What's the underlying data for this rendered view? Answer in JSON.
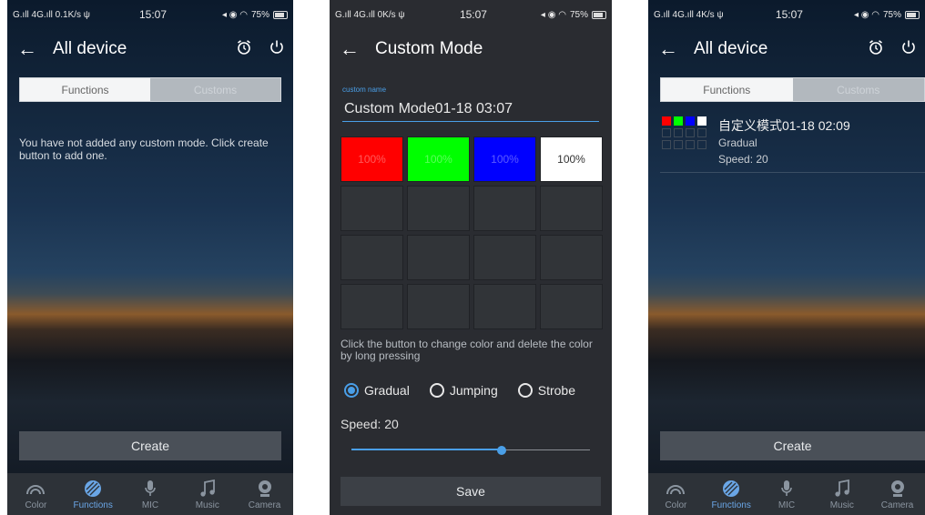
{
  "statusbar": [
    {
      "left": "G.ıll 4G.ıll 0.1K/s ψ",
      "time": "15:07",
      "right": "75%"
    },
    {
      "left": "G.ıll 4G.ıll 0K/s ψ",
      "time": "15:07",
      "right": "75%"
    },
    {
      "left": "G.ıll 4G.ıll 4K/s ψ",
      "time": "15:07",
      "right": "75%"
    }
  ],
  "screen1": {
    "title": "All device",
    "tabs": [
      "Functions",
      "Customs"
    ],
    "empty_message": "You have not added any custom mode. Click create button to add one.",
    "create_label": "Create"
  },
  "screen2": {
    "title": "Custom Mode",
    "field_label": "custom name",
    "name_value": "Custom Mode01-18 03:07",
    "colors": [
      {
        "hex": "#ff0000",
        "label": "100%"
      },
      {
        "hex": "#00ff00",
        "label": "100%"
      },
      {
        "hex": "#0000ff",
        "label": "100%"
      },
      {
        "hex": "#ffffff",
        "label": "100%"
      }
    ],
    "hint": "Click the button to change color and delete the color by long pressing",
    "modes": [
      "Gradual",
      "Jumping",
      "Strobe"
    ],
    "selected_mode": "Gradual",
    "speed_label": "Speed: 20",
    "speed_fraction": 0.63,
    "save_label": "Save"
  },
  "screen3": {
    "title": "All device",
    "tabs": [
      "Functions",
      "Customs"
    ],
    "item": {
      "name": "自定义模式01-18 02:09",
      "mode": "Gradual",
      "speed": "Speed: 20",
      "swatches": [
        "#ff0000",
        "#00ff00",
        "#0000ff",
        "#ffffff"
      ]
    },
    "create_label": "Create"
  },
  "nav": {
    "items": [
      "Color",
      "Functions",
      "MIC",
      "Music",
      "Camera"
    ],
    "active": "Functions"
  },
  "colors": {
    "accent": "#4a9fe8",
    "nav_active": "#6aa6e6",
    "nav_bg": "#2d3238"
  }
}
